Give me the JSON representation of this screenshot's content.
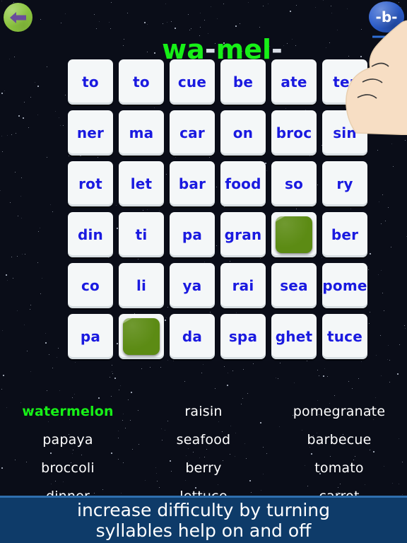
{
  "app": {
    "background_color": "#0a0d18",
    "accent_green": "#17f017",
    "tile_text_color": "#1a1ae0"
  },
  "header": {
    "back_button": {
      "label": "",
      "icon": "arrow-left-icon",
      "circle_color": "#8cc63f",
      "arrow_color": "#6a4c9c"
    },
    "title_parts": [
      {
        "text": "wa",
        "type": "syllable"
      },
      {
        "text": "-",
        "type": "separator"
      },
      {
        "text": "mel",
        "type": "syllable"
      },
      {
        "text": "-",
        "type": "separator"
      }
    ],
    "title_plain": "wa-mel-",
    "mode_button": {
      "label": "-b-",
      "color": "#2a5ccc",
      "arrow_icon": "arrow-right-icon"
    }
  },
  "grid": {
    "rows": 6,
    "cols": 6,
    "tiles": [
      [
        {
          "label": "to",
          "used": false
        },
        {
          "label": "to",
          "used": false
        },
        {
          "label": "cue",
          "used": false
        },
        {
          "label": "be",
          "used": false
        },
        {
          "label": "ate",
          "used": false
        },
        {
          "label": "ter",
          "used": false
        }
      ],
      [
        {
          "label": "ner",
          "used": false
        },
        {
          "label": "ma",
          "used": false
        },
        {
          "label": "car",
          "used": false
        },
        {
          "label": "on",
          "used": false
        },
        {
          "label": "broc",
          "used": false
        },
        {
          "label": "sin",
          "used": false
        }
      ],
      [
        {
          "label": "rot",
          "used": false
        },
        {
          "label": "let",
          "used": false
        },
        {
          "label": "bar",
          "used": false
        },
        {
          "label": "food",
          "used": false
        },
        {
          "label": "so",
          "used": false
        },
        {
          "label": "ry",
          "used": false
        }
      ],
      [
        {
          "label": "din",
          "used": false
        },
        {
          "label": "ti",
          "used": false
        },
        {
          "label": "pa",
          "used": false
        },
        {
          "label": "gran",
          "used": false
        },
        {
          "label": "",
          "used": true
        },
        {
          "label": "ber",
          "used": false
        }
      ],
      [
        {
          "label": "co",
          "used": false
        },
        {
          "label": "li",
          "used": false
        },
        {
          "label": "ya",
          "used": false
        },
        {
          "label": "rai",
          "used": false
        },
        {
          "label": "sea",
          "used": false
        },
        {
          "label": "pome",
          "used": false
        }
      ],
      [
        {
          "label": "pa",
          "used": false
        },
        {
          "label": "",
          "used": true
        },
        {
          "label": "da",
          "used": false
        },
        {
          "label": "spa",
          "used": false
        },
        {
          "label": "ghet",
          "used": false
        },
        {
          "label": "tuce",
          "used": false
        }
      ]
    ]
  },
  "word_list": {
    "rows": [
      [
        {
          "text": "watermelon",
          "found": true
        },
        {
          "text": "raisin",
          "found": false
        },
        {
          "text": "pomegranate",
          "found": false
        }
      ],
      [
        {
          "text": "papaya",
          "found": false
        },
        {
          "text": "seafood",
          "found": false
        },
        {
          "text": "barbecue",
          "found": false
        }
      ],
      [
        {
          "text": "broccoli",
          "found": false
        },
        {
          "text": "berry",
          "found": false
        },
        {
          "text": "tomato",
          "found": false
        }
      ],
      [
        {
          "text": "dinner",
          "found": false
        },
        {
          "text": "lettuce",
          "found": false
        },
        {
          "text": "carrot",
          "found": false
        }
      ]
    ]
  },
  "banner": {
    "line1": "increase difficulty by turning",
    "line2": "syllables help on and off",
    "background_color": "#0e3b69"
  }
}
